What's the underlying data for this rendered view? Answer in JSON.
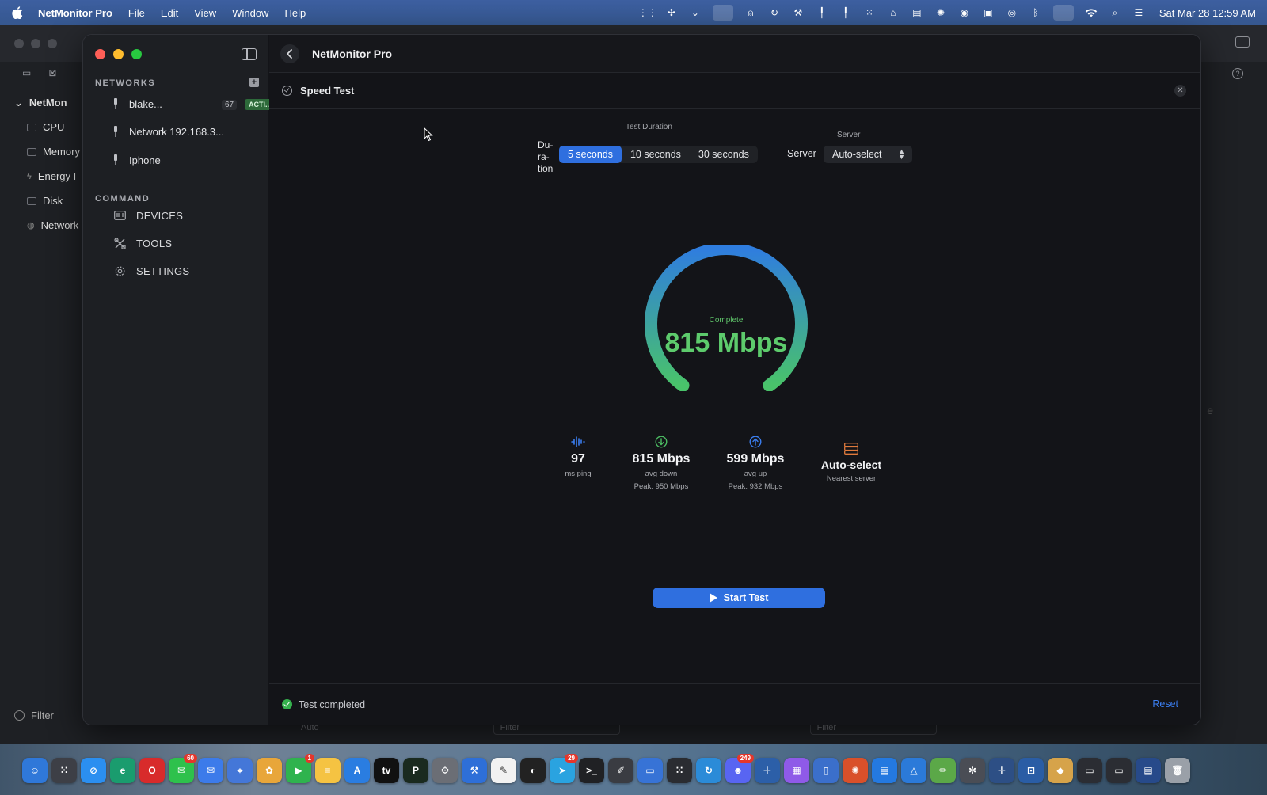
{
  "menubar": {
    "app_name": "NetMonitor Pro",
    "menus": [
      "File",
      "Edit",
      "View",
      "Window",
      "Help"
    ],
    "clock": "Sat Mar 28  12:59 AM"
  },
  "background_window": {
    "nav": [
      "NetMon",
      "CPU",
      "Memory",
      "Energy I",
      "Disk",
      "Network"
    ],
    "filter_label": "Filter",
    "bottom_auto": "Auto",
    "bottom_filter_1": "Filter",
    "bottom_filter_2": "Filter"
  },
  "sidebar": {
    "networks_header": "NETWORKS",
    "networks": [
      {
        "name": "blake...",
        "count": "67",
        "status": "ACTI..."
      },
      {
        "name": "Network 192.168.3..."
      },
      {
        "name": "Iphone"
      }
    ],
    "command_header": "COMMAND",
    "commands": [
      {
        "label": "DEVICES",
        "icon": "devices-icon"
      },
      {
        "label": "TOOLS",
        "icon": "tools-icon"
      },
      {
        "label": "SETTINGS",
        "icon": "gear-icon"
      }
    ]
  },
  "header": {
    "title": "NetMonitor Pro"
  },
  "panel": {
    "title": "Speed Test",
    "test_duration_label": "Test Duration",
    "duration_word": "Du-\nra-\ntion",
    "duration_options": [
      "5 seconds",
      "10 seconds",
      "30 seconds"
    ],
    "duration_selected": "5 seconds",
    "server_group_label": "Server",
    "server_label": "Server",
    "server_value": "Auto-select"
  },
  "gauge": {
    "status": "Complete",
    "value": "815 Mbps",
    "fraction": 1.0
  },
  "stats": {
    "ping": {
      "value": "97",
      "label": "ms ping"
    },
    "down": {
      "value": "815 Mbps",
      "label": "avg down",
      "peak": "Peak: 950 Mbps"
    },
    "up": {
      "value": "599 Mbps",
      "label": "avg up",
      "peak": "Peak: 932 Mbps"
    },
    "server": {
      "value": "Auto-select",
      "label": "Nearest server"
    }
  },
  "actions": {
    "start_label": "Start Test"
  },
  "footer": {
    "status": "Test completed",
    "reset_label": "Reset"
  },
  "dock": {
    "badges": {
      "messages": "60",
      "facetime": "1",
      "telegram": "29",
      "discord": "249"
    }
  },
  "colors": {
    "accent": "#2f6fdf",
    "success": "#5dcb6c",
    "gauge_start": "#2f7ddf",
    "gauge_end": "#49c36a"
  }
}
